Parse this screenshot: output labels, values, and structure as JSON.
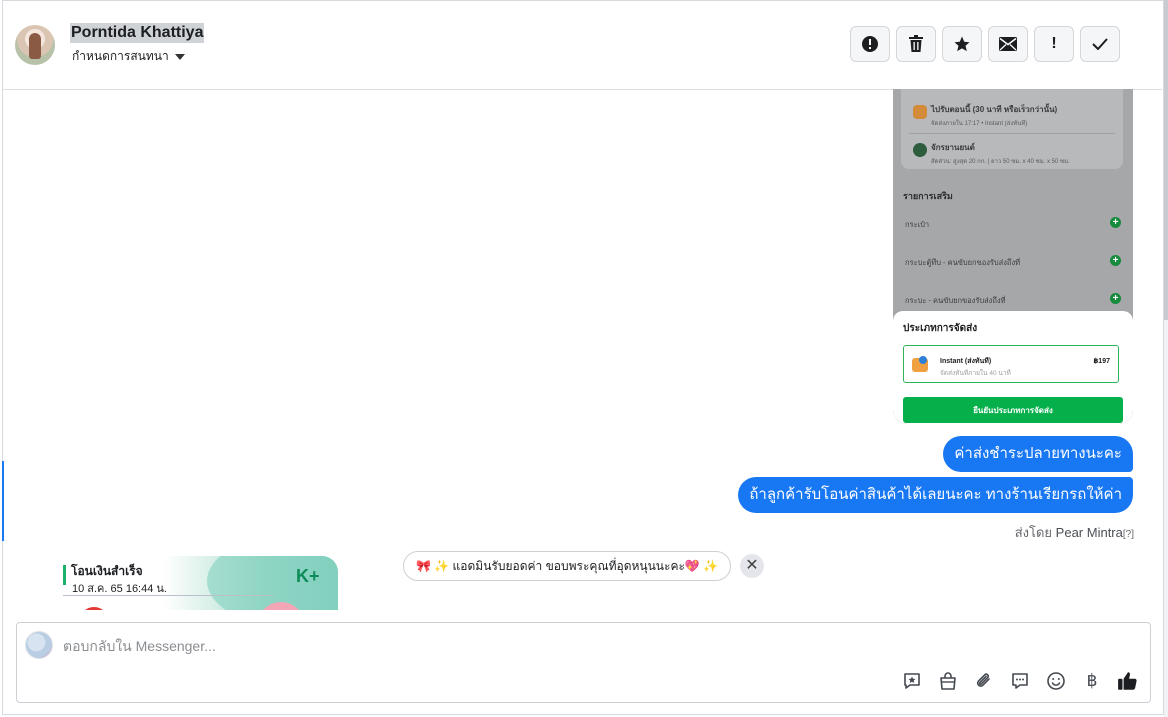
{
  "header": {
    "contact_name": "Porntida Khattiya",
    "assign_label": "กำหนดการสนทนา",
    "actions": [
      {
        "name": "spam",
        "icon": "exclamation-circle-icon"
      },
      {
        "name": "delete",
        "icon": "trash-icon"
      },
      {
        "name": "star",
        "icon": "star-icon"
      },
      {
        "name": "mark-unread",
        "icon": "envelope-icon"
      },
      {
        "name": "follow-up",
        "icon": "exclamation-icon",
        "glyph": "!"
      },
      {
        "name": "done",
        "icon": "check-icon"
      }
    ]
  },
  "screenshot_image": {
    "top_option_1": "ไปรับตอนนี้ (30 นาที หรือเร็วกว่านั้น)",
    "top_option_1_sub": "จัดส่งภายใน 17:17 • Instant (ส่งทันที)",
    "top_option_2": "จักรยานยนต์",
    "top_option_2_sub": "สัดส่วน: สูงสุด 20 กก. | ยาว 50 ซม. x 40 ซม. x 50 ซม.",
    "extras_heading": "รายการเสริม",
    "extras": [
      "กระเป๋า",
      "กระบะตู้ทึบ - คนขับยกของรับส่งถึงที่",
      "กระบะ - คนขับยกของรับส่งถึงที่"
    ],
    "sheet_title": "ประเภทการจัดส่ง",
    "option_name": "Instant (ส่งทันที)",
    "option_sub": "จัดส่งทันทีภายใน 40 นาที",
    "option_price": "฿197",
    "confirm_label": "ยืนยันประเภทการจัดส่ง"
  },
  "messages": {
    "outgoing_1": "ค่าส่งชำระปลายทางนะคะ",
    "outgoing_2": "ถ้าลูกค้ารับโอนค่าสินค้าได้เลยนะคะ ทางร้านเรียกรถให้ค่า",
    "sent_by_prefix": "ส่งโดย",
    "sent_by_name": "Pear Mintra",
    "sent_by_help": "[?]"
  },
  "receipt": {
    "title": "โอนเงินสำเร็จ",
    "datetime": "10 ส.ค. 65  16:44 น.",
    "bank_logo": "K+"
  },
  "suggested_reply": {
    "text": "🎀 ✨ แอดมินรับยอดค่า ขอบพระคุณที่อุดหนุนนะคะ💖 ✨",
    "close_glyph": "✕"
  },
  "composer": {
    "placeholder": "ตอบกลับใน Messenger...",
    "tools": [
      "saved-reply-icon",
      "shop-bag-icon",
      "attachment-icon",
      "chat-bubble-icon",
      "emoji-icon",
      "baht-icon",
      "thumbs-up-icon"
    ],
    "baht_glyph": "฿"
  },
  "colors": {
    "messenger_blue": "#1877f2",
    "confirm_green": "#05b04b",
    "kplus_green": "#0e8b5a"
  }
}
